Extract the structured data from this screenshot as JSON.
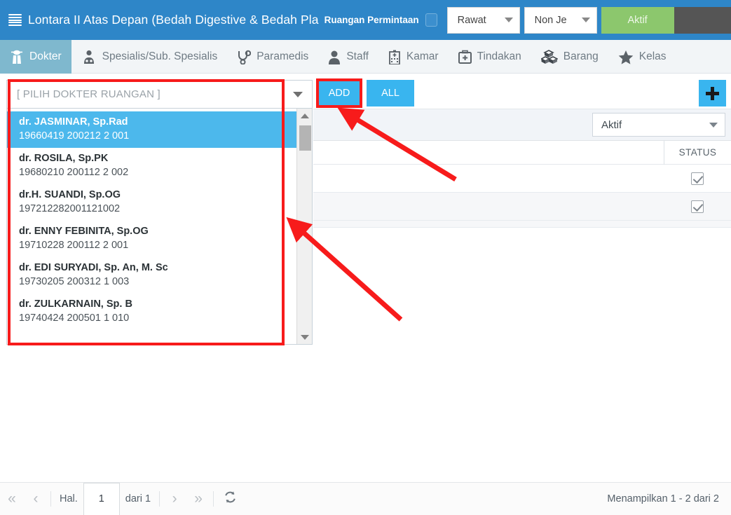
{
  "header": {
    "menu_icon": "list-icon",
    "title": "Lontara II Atas Depan (Bedah Digestive & Bedah Pla",
    "subtitle": "Ruangan Permintaan",
    "checkbox_name": "ruangan-permintaan-checkbox",
    "select_rawat": "Rawat",
    "select_jenis": "Non Je",
    "button_aktif": "Aktif"
  },
  "tabs": [
    {
      "label": "Dokter",
      "icon": "doctor-icon",
      "active": true
    },
    {
      "label": "Spesialis/Sub. Spesialis",
      "icon": "specialist-icon",
      "active": false
    },
    {
      "label": "Paramedis",
      "icon": "stethoscope-icon",
      "active": false
    },
    {
      "label": "Staff",
      "icon": "person-icon",
      "active": false
    },
    {
      "label": "Kamar",
      "icon": "hospital-building-icon",
      "active": false
    },
    {
      "label": "Tindakan",
      "icon": "medical-kit-icon",
      "active": false
    },
    {
      "label": "Barang",
      "icon": "boxes-icon",
      "active": false
    },
    {
      "label": "Kelas",
      "icon": "star-icon",
      "active": false
    }
  ],
  "combo": {
    "placeholder": "[ PILIH DOKTER RUANGAN ]",
    "value": "",
    "caret_icon": "chevron-down-icon",
    "options": [
      {
        "name": "dr. JASMINAR, Sp.Rad",
        "id": "19660419 200212 2 001",
        "selected": true
      },
      {
        "name": "dr. ROSILA, Sp.PK",
        "id": "19680210 200112 2 002",
        "selected": false
      },
      {
        "name": "dr.H. SUANDI, Sp.OG",
        "id": "197212282001121002",
        "selected": false
      },
      {
        "name": "dr. ENNY FEBINITA, Sp.OG",
        "id": "19710228 200112 2 001",
        "selected": false
      },
      {
        "name": "dr. EDI SURYADI, Sp. An, M. Sc",
        "id": "19730205 200312 1 003",
        "selected": false
      },
      {
        "name": "dr. ZULKARNAIN, Sp. B",
        "id": "19740424 200501 1 010",
        "selected": false
      }
    ]
  },
  "actions": {
    "add_label": "ADD",
    "all_label": "ALL",
    "plus_icon": "plus-icon"
  },
  "grid": {
    "filter_value": "Aktif",
    "columns": [
      "STATUS"
    ],
    "rows": [
      {
        "status_checked": true
      },
      {
        "status_checked": true
      }
    ]
  },
  "pagination": {
    "first_icon": "double-chevron-left-icon",
    "prev_icon": "chevron-left-icon",
    "page_label": "Hal.",
    "page_value": "1",
    "of_label": "dari 1",
    "next_icon": "chevron-right-icon",
    "last_icon": "double-chevron-right-icon",
    "refresh_icon": "refresh-icon",
    "summary": "Menampilkan 1 - 2 dari 2"
  },
  "colors": {
    "header_blue": "#2e86c8",
    "tab_active": "#7fb8ce",
    "accent_blue": "#39b5ef",
    "option_selected": "#4cb8ec",
    "green_button": "#8cc76d",
    "dark_button": "#555555",
    "annotation_red": "#f71b1b"
  }
}
